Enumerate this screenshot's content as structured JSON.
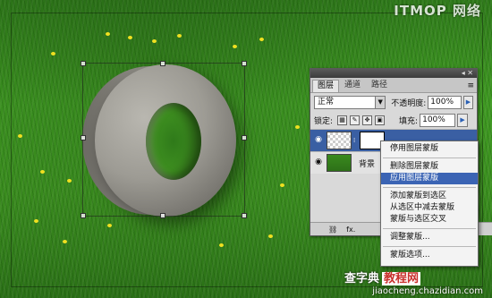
{
  "watermark": {
    "top_brand": "ITMOP 网络",
    "bottom_brand_1": "查字典",
    "bottom_brand_2": "教程网",
    "url": "jiaocheng.chazidian.com"
  },
  "layers_panel": {
    "tabs": [
      {
        "label": "图层",
        "active": true
      },
      {
        "label": "通道",
        "active": false
      },
      {
        "label": "路径",
        "active": false
      }
    ],
    "menu_glyph": "≡",
    "collapse_glyph": "◂ ✕",
    "blend_mode": "正常",
    "opacity_label": "不透明度:",
    "opacity_value": "100%",
    "lock_label": "锁定:",
    "fill_label": "填充:",
    "fill_value": "100%",
    "layers": [
      {
        "name": "",
        "selected": true,
        "has_mask": true
      },
      {
        "name": "背景",
        "selected": false,
        "has_mask": false
      }
    ],
    "footer_icons": [
      "link-icon",
      "fx-icon"
    ],
    "footer_text": [
      "⛓",
      "fx."
    ]
  },
  "context_menu": {
    "items": [
      {
        "label": "停用图层蒙版",
        "highlight": false
      },
      {
        "sep": true
      },
      {
        "label": "删除图层蒙版",
        "highlight": false
      },
      {
        "label": "应用图层蒙版",
        "highlight": true
      },
      {
        "sep": true
      },
      {
        "label": "添加蒙版到选区",
        "highlight": false
      },
      {
        "label": "从选区中减去蒙版",
        "highlight": false
      },
      {
        "label": "蒙版与选区交叉",
        "highlight": false
      },
      {
        "sep": true
      },
      {
        "label": "调整蒙版...",
        "highlight": false
      },
      {
        "sep": true
      },
      {
        "label": "蒙版选项...",
        "highlight": false
      }
    ]
  },
  "colors": {
    "menu_highlight": "#3b64b4",
    "grass": "#3f9a22",
    "flower": "#f0e020"
  }
}
